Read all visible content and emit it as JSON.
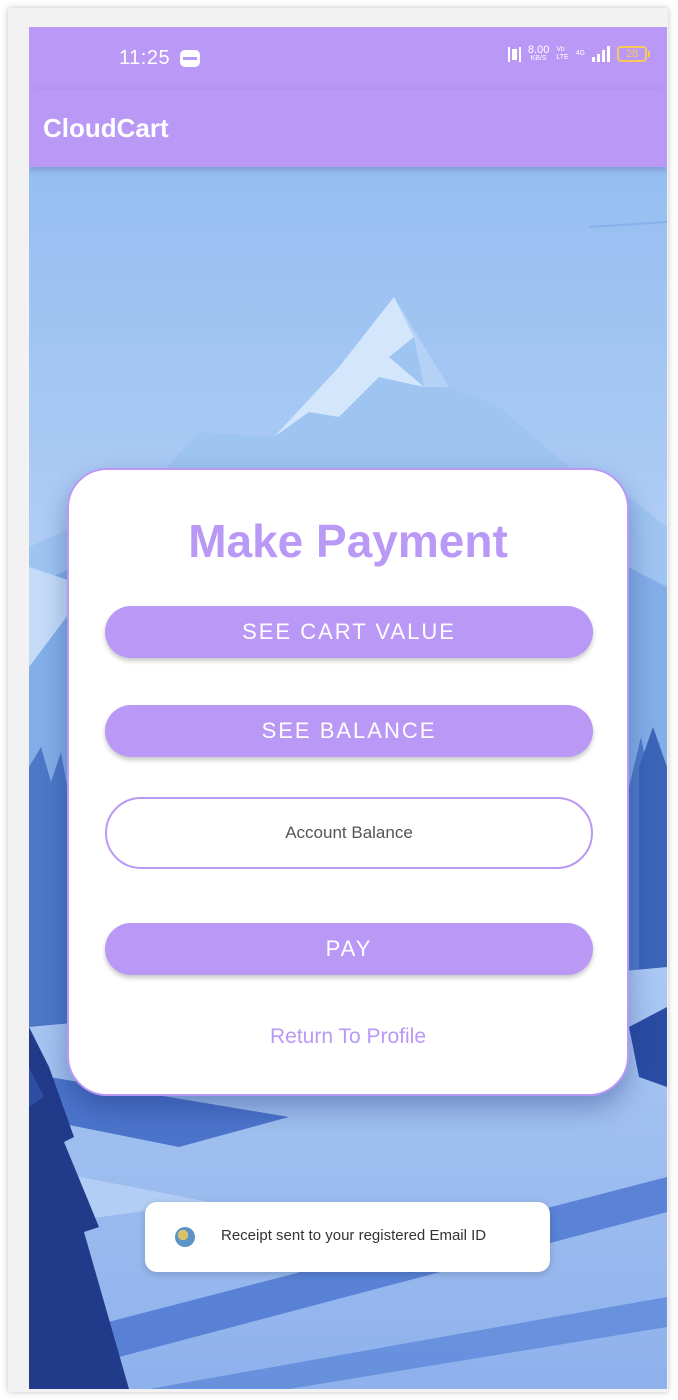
{
  "status_bar": {
    "time": "11:25",
    "net_speed": "8.00",
    "net_speed_unit": "KB/S",
    "volte": "Vo",
    "lte": "LTE",
    "network_type": "4G",
    "battery": "28"
  },
  "app_bar": {
    "title": "CloudCart"
  },
  "payment": {
    "title": "Make Payment",
    "see_cart_value_label": "SEE CART VALUE",
    "see_balance_label": "SEE BALANCE",
    "account_balance_placeholder": "Account Balance",
    "pay_label": "PAY",
    "return_link": "Return To Profile"
  },
  "toast": {
    "message": "Receipt sent to your registered Email ID"
  },
  "colors": {
    "accent": "#b998f6",
    "sky_top": "#8bbaf0",
    "snow": "#a8c8f4",
    "tree_dark": "#213b8a"
  },
  "icons": {
    "status_message": "message-icon",
    "vibrate": "vibrate-icon",
    "signal": "signal-icon",
    "battery": "battery-icon",
    "toast_app": "app-icon"
  }
}
